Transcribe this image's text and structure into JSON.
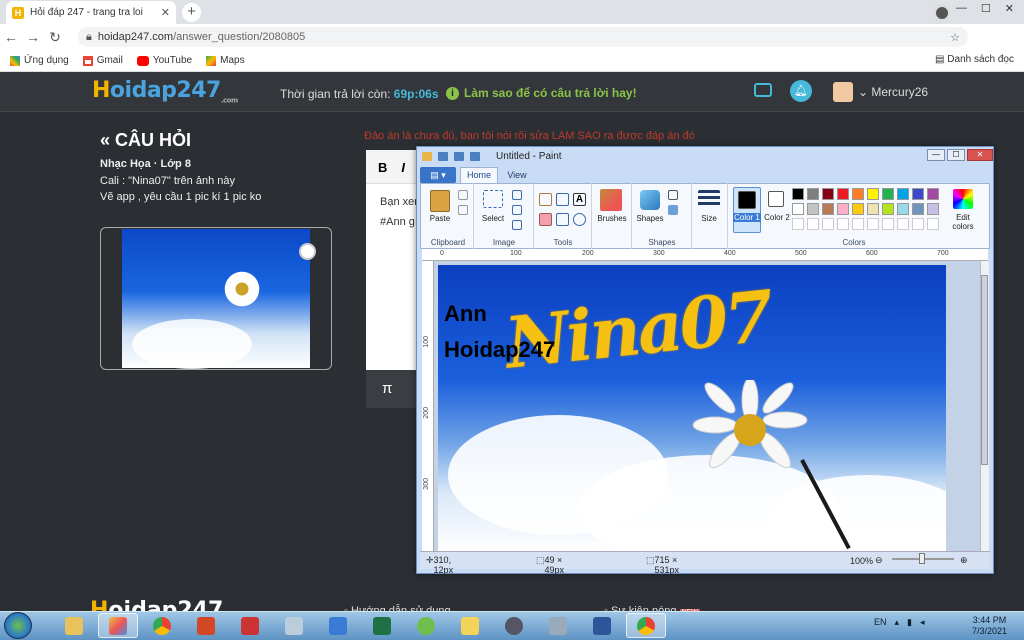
{
  "browser": {
    "tab_title": "Hỏi đáp 247 - trang tra loi",
    "url_domain": "hoidap247.com",
    "url_path": "/answer_question/2080805",
    "bookmarks": [
      "Ứng dụng",
      "Gmail",
      "YouTube",
      "Maps"
    ],
    "reading_list": "Danh sách đọc"
  },
  "site": {
    "logo_h": "H",
    "logo_rest": "oidap247",
    "logo_sub": ".com",
    "timer_label": "Thời gian trả lời còn:",
    "timer_value": "69p:06s",
    "howto": "Làm sao để có câu trả lời hay!",
    "username": "Mercury26"
  },
  "question": {
    "heading": "CÂU HỎI",
    "subject": "Nhạc Họa · Lớp 8",
    "line1": "Cali : \"Nina07\" trên ảnh này",
    "line2": "Vẽ app , yêu cầu 1 pic kí 1 pic ko"
  },
  "editor": {
    "notice": "Đảo án là chưa đủ, bạn tôi nói rõi sửa LÀM SAO ra được đáp án đó.",
    "bold": "B",
    "italic": "I",
    "text1": "Bạn xem",
    "text2": "#Ann g",
    "footer_symbol": "π"
  },
  "footer": {
    "logo_h": "H",
    "logo_rest": "oidap247",
    "link1": "Hướng dẫn sử dụng",
    "link2": "Sự kiện nóng"
  },
  "paint": {
    "title": "Untitled - Paint",
    "tab_home": "Home",
    "tab_view": "View",
    "groups": {
      "clipboard": "Clipboard",
      "image": "Image",
      "tools": "Tools",
      "shapes": "Shapes",
      "colors": "Colors"
    },
    "buttons": {
      "paste": "Paste",
      "select": "Select",
      "brushes": "Brushes",
      "shapes": "Shapes",
      "size": "Size",
      "color1": "Color 1",
      "color2": "Color 2",
      "edit_colors": "Edit colors"
    },
    "ruler_h": [
      "0",
      "100",
      "200",
      "300",
      "400",
      "500",
      "600",
      "700"
    ],
    "ruler_v": [
      "100",
      "200",
      "300"
    ],
    "canvas_text_nina": "Nina07",
    "canvas_text_ann": "Ann",
    "canvas_text_site": "Hoidap247",
    "status_pos": "310, 12px",
    "status_sel": "49 × 49px",
    "status_size": "715 × 531px",
    "zoom": "100%",
    "palette_row1": [
      "#000000",
      "#7f7f7f",
      "#880015",
      "#ed1c24",
      "#ff7f27",
      "#fff200",
      "#22b14c",
      "#00a2e8",
      "#3f48cc",
      "#a349a4"
    ],
    "palette_row2": [
      "#ffffff",
      "#c3c3c3",
      "#b97a57",
      "#ffaec9",
      "#ffc90e",
      "#efe4b0",
      "#b5e61d",
      "#99d9ea",
      "#7092be",
      "#c8bfe7"
    ],
    "color1": "#000000",
    "color2": "#ffffff"
  },
  "taskbar": {
    "lang": "EN",
    "time": "3:44 PM",
    "date": "7/3/2021"
  }
}
